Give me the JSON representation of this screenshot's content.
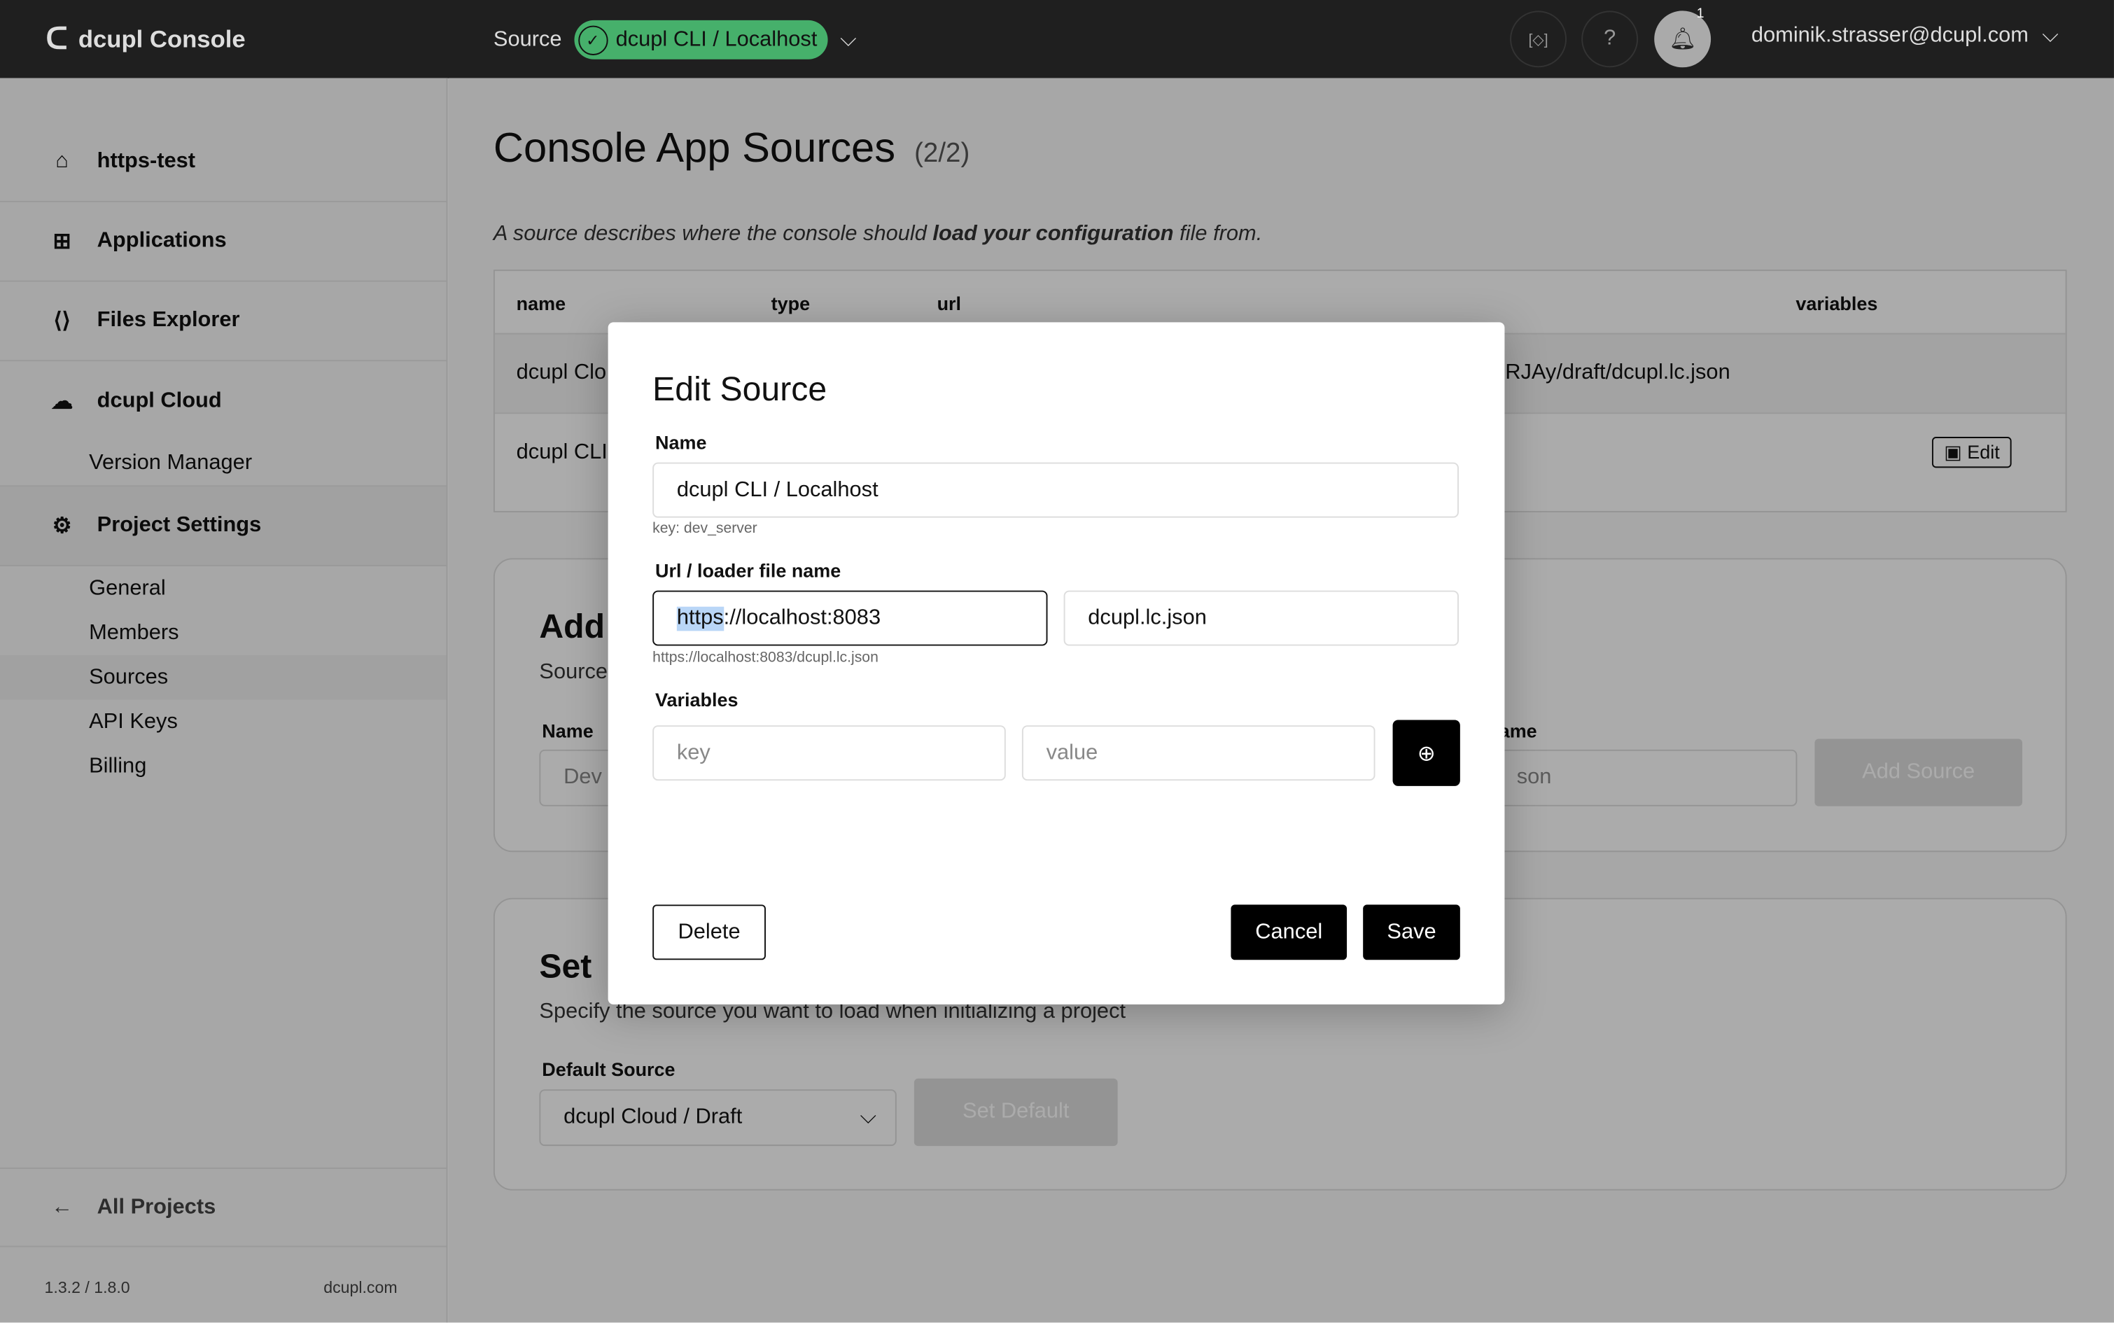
{
  "header": {
    "app_title": "dcupl Console",
    "source_label": "Source",
    "source_value": "dcupl CLI / Localhost",
    "notification_count": "1",
    "user_email": "dominik.strasser@dcupl.com",
    "source_status_color": "#46b06b"
  },
  "sidebar": {
    "project": "https-test",
    "items": [
      {
        "label": "Applications"
      },
      {
        "label": "Files Explorer"
      },
      {
        "label": "dcupl Cloud"
      }
    ],
    "cloud_sub": "Version Manager",
    "settings": "Project Settings",
    "settings_sub": [
      "General",
      "Members",
      "Sources",
      "API Keys",
      "Billing"
    ],
    "all_projects": "All Projects",
    "version": "1.3.2 / 1.8.0",
    "site": "dcupl.com"
  },
  "main": {
    "title": "Console App Sources",
    "count": "(2/2)",
    "desc_pre": "A source describes where the console should ",
    "desc_bold": "load your configuration",
    "desc_post": " file from.",
    "table": {
      "headers": [
        "name",
        "type",
        "url",
        "variables"
      ],
      "rows": [
        {
          "name": "dcupl Clo",
          "url": "IRJAy/draft/dcupl.lc.json"
        },
        {
          "name": "dcupl CLI",
          "edit": "Edit"
        }
      ]
    },
    "add": {
      "title": "Add",
      "sub": "Source",
      "name_label": "Name",
      "name_placeholder": "Dev",
      "file_label": "ame",
      "file_placeholder": "son",
      "button": "Add Source"
    },
    "set": {
      "title": "Set",
      "sub": "Specify the source you want to load when initializing a project",
      "label": "Default Source",
      "value": "dcupl Cloud / Draft",
      "button": "Set Default"
    }
  },
  "modal": {
    "title": "Edit Source",
    "name_label": "Name",
    "name_value": "dcupl CLI / Localhost",
    "key_hint": "key: dev_server",
    "url_label": "Url / loader file name",
    "url_selected": "https",
    "url_rest": "://localhost:8083",
    "file_value": "dcupl.lc.json",
    "url_hint": "https://localhost:8083/dcupl.lc.json",
    "vars_label": "Variables",
    "key_placeholder": "key",
    "value_placeholder": "value",
    "delete": "Delete",
    "cancel": "Cancel",
    "save": "Save"
  }
}
